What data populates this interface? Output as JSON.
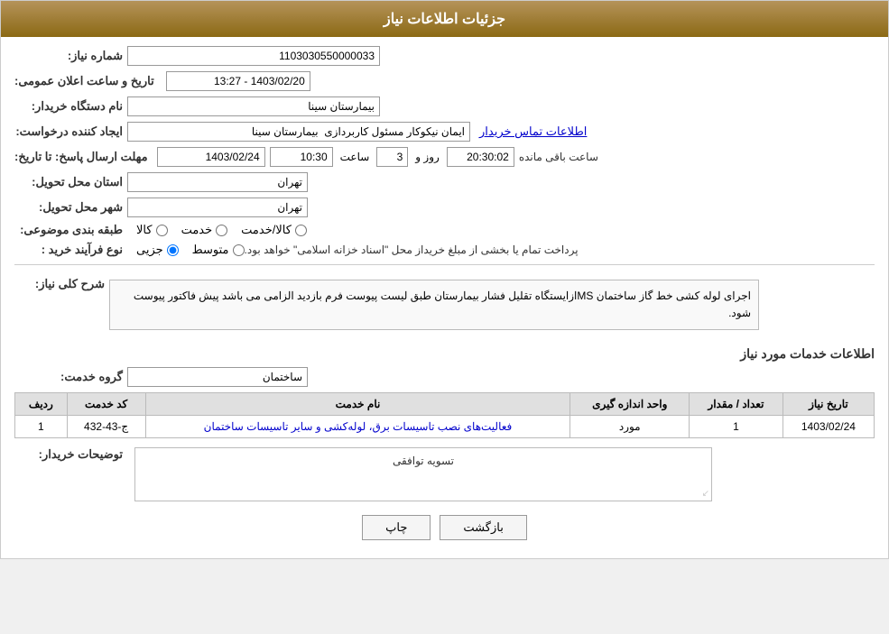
{
  "header": {
    "title": "جزئیات اطلاعات نیاز"
  },
  "form": {
    "need_number_label": "شماره نیاز:",
    "need_number_value": "1103030550000033",
    "announcement_label": "تاریخ و ساعت اعلان عمومی:",
    "announcement_value": "1403/02/20 - 13:27",
    "buyer_name_label": "نام دستگاه خریدار:",
    "buyer_name_value": "بیمارستان سینا",
    "creator_label": "ایجاد کننده درخواست:",
    "creator_value": "ایمان نیکوکار مسئول کاربردازی  بیمارستان سینا",
    "contact_link": "اطلاعات تماس خریدار",
    "response_date_label": "مهلت ارسال پاسخ: تا تاریخ:",
    "response_date_value": "1403/02/24",
    "response_time_label": "ساعت",
    "response_time_value": "10:30",
    "response_day_label": "روز و",
    "response_day_value": "3",
    "response_remaining_label": "ساعت باقی مانده",
    "response_remaining_value": "20:30:02",
    "province_label": "استان محل تحویل:",
    "province_value": "تهران",
    "city_label": "شهر محل تحویل:",
    "city_value": "تهران",
    "category_label": "طبقه بندی موضوعی:",
    "category_goods": "کالا",
    "category_service": "خدمت",
    "category_goods_service": "کالا/خدمت",
    "purchase_type_label": "نوع فرآیند خرید :",
    "purchase_type_partial": "جزیی",
    "purchase_type_medium": "متوسط",
    "purchase_note": "پرداخت تمام یا بخشی از مبلغ خریداز محل \"اسناد خزانه اسلامی\" خواهد بود.",
    "description_label": "شرح کلی نیاز:",
    "description_text": "اجرای لوله کشی خط گاز ساختمان MSازایستگاه تقلیل فشار بیمارستان طبق لیست پیوست فرم بازدید الزامی می باشد پیش فاکتور پیوست شود.",
    "services_label": "اطلاعات خدمات مورد نیاز",
    "group_label": "گروه خدمت:",
    "group_value": "ساختمان",
    "table": {
      "col_row": "ردیف",
      "col_code": "کد خدمت",
      "col_name": "نام خدمت",
      "col_unit": "واحد اندازه گیری",
      "col_count": "تعداد / مقدار",
      "col_date": "تاریخ نیاز",
      "rows": [
        {
          "row": "1",
          "code": "ج-43-432",
          "name": "فعالیت‌های نصب تاسیسات برق، لوله‌کشی و سایر تاسیسات ساختمان",
          "unit": "مورد",
          "count": "1",
          "date": "1403/02/24"
        }
      ]
    },
    "buyer_comments_label": "توضیحات خریدار:",
    "buyer_comments_value": "تسویه توافقی"
  },
  "buttons": {
    "print": "چاپ",
    "back": "بازگشت"
  }
}
